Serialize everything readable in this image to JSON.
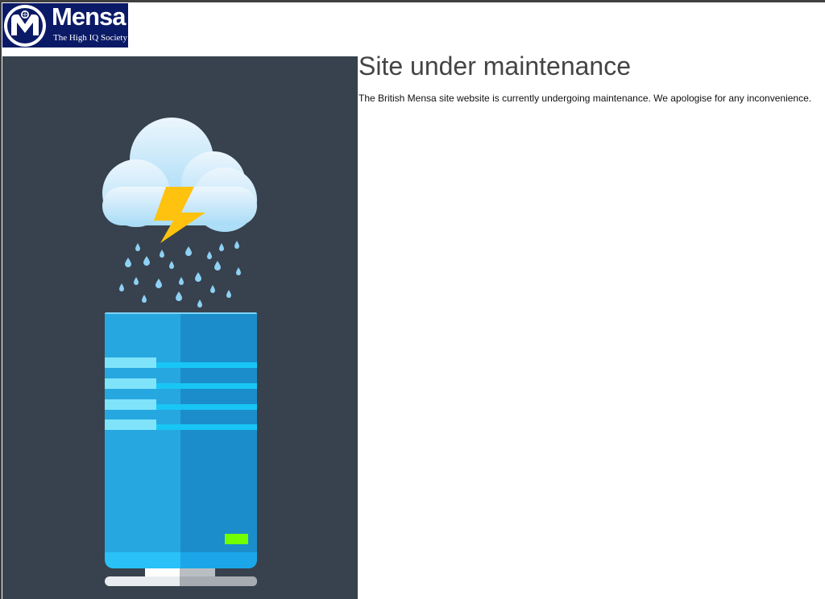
{
  "logo": {
    "wordmark": "Mensa",
    "tagline": "The High IQ Society",
    "background": "#0b1a66"
  },
  "illustration": {
    "icons": [
      "cloud-icon",
      "lightning-icon",
      "raindrop-icon",
      "server-icon",
      "status-light-icon"
    ],
    "background": "#37424e"
  },
  "main": {
    "title": "Site under maintenance",
    "message": "The British Mensa site website is currently undergoing maintenance. We apologise for any inconvenience."
  }
}
